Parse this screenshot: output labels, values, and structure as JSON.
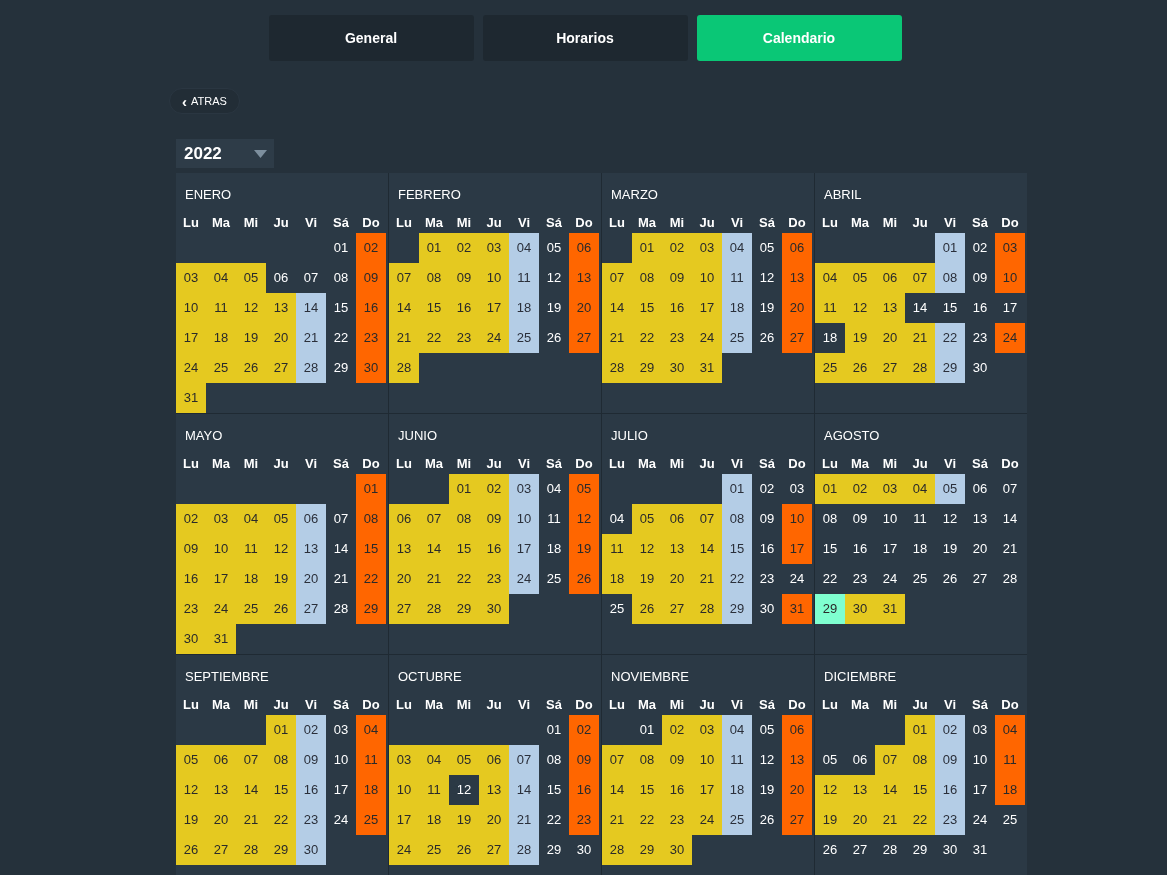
{
  "tabs": [
    {
      "label": "General",
      "selected": false
    },
    {
      "label": "Horarios",
      "selected": false
    },
    {
      "label": "Calendario",
      "selected": true
    }
  ],
  "back_button": {
    "icon": "‹",
    "label": "ATRAS"
  },
  "year_select": {
    "value": "2022"
  },
  "months": [
    {
      "name": "ENERO",
      "weekdays": [
        "Lu",
        "Ma",
        "Mi",
        "Ju",
        "Vi",
        "Sá",
        "Do"
      ],
      "weeks": [
        [
          {
            "kind": "blank"
          },
          {
            "kind": "blank"
          },
          {
            "kind": "blank"
          },
          {
            "kind": "blank"
          },
          {
            "kind": "blank"
          },
          {
            "day": "01",
            "kind": "off"
          },
          {
            "day": "02",
            "kind": "sun"
          }
        ],
        [
          {
            "day": "03",
            "kind": "work"
          },
          {
            "day": "04",
            "kind": "work"
          },
          {
            "day": "05",
            "kind": "work"
          },
          {
            "day": "06",
            "kind": "off"
          },
          {
            "day": "07",
            "kind": "off"
          },
          {
            "day": "08",
            "kind": "off"
          },
          {
            "day": "09",
            "kind": "sun"
          }
        ],
        [
          {
            "day": "10",
            "kind": "work"
          },
          {
            "day": "11",
            "kind": "work"
          },
          {
            "day": "12",
            "kind": "work"
          },
          {
            "day": "13",
            "kind": "work"
          },
          {
            "day": "14",
            "kind": "fri"
          },
          {
            "day": "15",
            "kind": "off"
          },
          {
            "day": "16",
            "kind": "sun"
          }
        ],
        [
          {
            "day": "17",
            "kind": "work"
          },
          {
            "day": "18",
            "kind": "work"
          },
          {
            "day": "19",
            "kind": "work"
          },
          {
            "day": "20",
            "kind": "work"
          },
          {
            "day": "21",
            "kind": "fri"
          },
          {
            "day": "22",
            "kind": "off"
          },
          {
            "day": "23",
            "kind": "sun"
          }
        ],
        [
          {
            "day": "24",
            "kind": "work"
          },
          {
            "day": "25",
            "kind": "work"
          },
          {
            "day": "26",
            "kind": "work"
          },
          {
            "day": "27",
            "kind": "work"
          },
          {
            "day": "28",
            "kind": "fri"
          },
          {
            "day": "29",
            "kind": "off"
          },
          {
            "day": "30",
            "kind": "sun"
          }
        ],
        [
          {
            "day": "31",
            "kind": "work"
          }
        ]
      ]
    },
    {
      "name": "FEBRERO",
      "weekdays": [
        "Lu",
        "Ma",
        "Mi",
        "Ju",
        "Vi",
        "Sá",
        "Do"
      ],
      "weeks": [
        [
          {
            "kind": "blank"
          },
          {
            "day": "01",
            "kind": "work"
          },
          {
            "day": "02",
            "kind": "work"
          },
          {
            "day": "03",
            "kind": "work"
          },
          {
            "day": "04",
            "kind": "fri"
          },
          {
            "day": "05",
            "kind": "off"
          },
          {
            "day": "06",
            "kind": "sun"
          }
        ],
        [
          {
            "day": "07",
            "kind": "work"
          },
          {
            "day": "08",
            "kind": "work"
          },
          {
            "day": "09",
            "kind": "work"
          },
          {
            "day": "10",
            "kind": "work"
          },
          {
            "day": "11",
            "kind": "fri"
          },
          {
            "day": "12",
            "kind": "off"
          },
          {
            "day": "13",
            "kind": "sun"
          }
        ],
        [
          {
            "day": "14",
            "kind": "work"
          },
          {
            "day": "15",
            "kind": "work"
          },
          {
            "day": "16",
            "kind": "work"
          },
          {
            "day": "17",
            "kind": "work"
          },
          {
            "day": "18",
            "kind": "fri"
          },
          {
            "day": "19",
            "kind": "off"
          },
          {
            "day": "20",
            "kind": "sun"
          }
        ],
        [
          {
            "day": "21",
            "kind": "work"
          },
          {
            "day": "22",
            "kind": "work"
          },
          {
            "day": "23",
            "kind": "work"
          },
          {
            "day": "24",
            "kind": "work"
          },
          {
            "day": "25",
            "kind": "fri"
          },
          {
            "day": "26",
            "kind": "off"
          },
          {
            "day": "27",
            "kind": "sun"
          }
        ],
        [
          {
            "day": "28",
            "kind": "work"
          }
        ]
      ]
    },
    {
      "name": "MARZO",
      "weekdays": [
        "Lu",
        "Ma",
        "Mi",
        "Ju",
        "Vi",
        "Sá",
        "Do"
      ],
      "weeks": [
        [
          {
            "kind": "blank"
          },
          {
            "day": "01",
            "kind": "work"
          },
          {
            "day": "02",
            "kind": "work"
          },
          {
            "day": "03",
            "kind": "work"
          },
          {
            "day": "04",
            "kind": "fri"
          },
          {
            "day": "05",
            "kind": "off"
          },
          {
            "day": "06",
            "kind": "sun"
          }
        ],
        [
          {
            "day": "07",
            "kind": "work"
          },
          {
            "day": "08",
            "kind": "work"
          },
          {
            "day": "09",
            "kind": "work"
          },
          {
            "day": "10",
            "kind": "work"
          },
          {
            "day": "11",
            "kind": "fri"
          },
          {
            "day": "12",
            "kind": "off"
          },
          {
            "day": "13",
            "kind": "sun"
          }
        ],
        [
          {
            "day": "14",
            "kind": "work"
          },
          {
            "day": "15",
            "kind": "work"
          },
          {
            "day": "16",
            "kind": "work"
          },
          {
            "day": "17",
            "kind": "work"
          },
          {
            "day": "18",
            "kind": "fri"
          },
          {
            "day": "19",
            "kind": "off"
          },
          {
            "day": "20",
            "kind": "sun"
          }
        ],
        [
          {
            "day": "21",
            "kind": "work"
          },
          {
            "day": "22",
            "kind": "work"
          },
          {
            "day": "23",
            "kind": "work"
          },
          {
            "day": "24",
            "kind": "work"
          },
          {
            "day": "25",
            "kind": "fri"
          },
          {
            "day": "26",
            "kind": "off"
          },
          {
            "day": "27",
            "kind": "sun"
          }
        ],
        [
          {
            "day": "28",
            "kind": "work"
          },
          {
            "day": "29",
            "kind": "work"
          },
          {
            "day": "30",
            "kind": "work"
          },
          {
            "day": "31",
            "kind": "work"
          }
        ]
      ]
    },
    {
      "name": "ABRIL",
      "weekdays": [
        "Lu",
        "Ma",
        "Mi",
        "Ju",
        "Vi",
        "Sá",
        "Do"
      ],
      "weeks": [
        [
          {
            "kind": "blank"
          },
          {
            "kind": "blank"
          },
          {
            "kind": "blank"
          },
          {
            "kind": "blank"
          },
          {
            "day": "01",
            "kind": "fri"
          },
          {
            "day": "02",
            "kind": "off"
          },
          {
            "day": "03",
            "kind": "sun"
          }
        ],
        [
          {
            "day": "04",
            "kind": "work"
          },
          {
            "day": "05",
            "kind": "work"
          },
          {
            "day": "06",
            "kind": "work"
          },
          {
            "day": "07",
            "kind": "work"
          },
          {
            "day": "08",
            "kind": "fri"
          },
          {
            "day": "09",
            "kind": "off"
          },
          {
            "day": "10",
            "kind": "sun"
          }
        ],
        [
          {
            "day": "11",
            "kind": "work"
          },
          {
            "day": "12",
            "kind": "work"
          },
          {
            "day": "13",
            "kind": "work"
          },
          {
            "day": "14",
            "kind": "off"
          },
          {
            "day": "15",
            "kind": "off"
          },
          {
            "day": "16",
            "kind": "off"
          },
          {
            "day": "17",
            "kind": "off"
          }
        ],
        [
          {
            "day": "18",
            "kind": "off"
          },
          {
            "day": "19",
            "kind": "work"
          },
          {
            "day": "20",
            "kind": "work"
          },
          {
            "day": "21",
            "kind": "work"
          },
          {
            "day": "22",
            "kind": "fri"
          },
          {
            "day": "23",
            "kind": "off"
          },
          {
            "day": "24",
            "kind": "sun"
          }
        ],
        [
          {
            "day": "25",
            "kind": "work"
          },
          {
            "day": "26",
            "kind": "work"
          },
          {
            "day": "27",
            "kind": "work"
          },
          {
            "day": "28",
            "kind": "work"
          },
          {
            "day": "29",
            "kind": "fri"
          },
          {
            "day": "30",
            "kind": "off"
          }
        ]
      ]
    },
    {
      "name": "MAYO",
      "weekdays": [
        "Lu",
        "Ma",
        "Mi",
        "Ju",
        "Vi",
        "Sá",
        "Do"
      ],
      "weeks": [
        [
          {
            "kind": "blank"
          },
          {
            "kind": "blank"
          },
          {
            "kind": "blank"
          },
          {
            "kind": "blank"
          },
          {
            "kind": "blank"
          },
          {
            "kind": "blank"
          },
          {
            "day": "01",
            "kind": "sun"
          }
        ],
        [
          {
            "day": "02",
            "kind": "work"
          },
          {
            "day": "03",
            "kind": "work"
          },
          {
            "day": "04",
            "kind": "work"
          },
          {
            "day": "05",
            "kind": "work"
          },
          {
            "day": "06",
            "kind": "fri"
          },
          {
            "day": "07",
            "kind": "off"
          },
          {
            "day": "08",
            "kind": "sun"
          }
        ],
        [
          {
            "day": "09",
            "kind": "work"
          },
          {
            "day": "10",
            "kind": "work"
          },
          {
            "day": "11",
            "kind": "work"
          },
          {
            "day": "12",
            "kind": "work"
          },
          {
            "day": "13",
            "kind": "fri"
          },
          {
            "day": "14",
            "kind": "off"
          },
          {
            "day": "15",
            "kind": "sun"
          }
        ],
        [
          {
            "day": "16",
            "kind": "work"
          },
          {
            "day": "17",
            "kind": "work"
          },
          {
            "day": "18",
            "kind": "work"
          },
          {
            "day": "19",
            "kind": "work"
          },
          {
            "day": "20",
            "kind": "fri"
          },
          {
            "day": "21",
            "kind": "off"
          },
          {
            "day": "22",
            "kind": "sun"
          }
        ],
        [
          {
            "day": "23",
            "kind": "work"
          },
          {
            "day": "24",
            "kind": "work"
          },
          {
            "day": "25",
            "kind": "work"
          },
          {
            "day": "26",
            "kind": "work"
          },
          {
            "day": "27",
            "kind": "fri"
          },
          {
            "day": "28",
            "kind": "off"
          },
          {
            "day": "29",
            "kind": "sun"
          }
        ],
        [
          {
            "day": "30",
            "kind": "work"
          },
          {
            "day": "31",
            "kind": "work"
          }
        ]
      ]
    },
    {
      "name": "JUNIO",
      "weekdays": [
        "Lu",
        "Ma",
        "Mi",
        "Ju",
        "Vi",
        "Sá",
        "Do"
      ],
      "weeks": [
        [
          {
            "kind": "blank"
          },
          {
            "kind": "blank"
          },
          {
            "day": "01",
            "kind": "work"
          },
          {
            "day": "02",
            "kind": "work"
          },
          {
            "day": "03",
            "kind": "fri"
          },
          {
            "day": "04",
            "kind": "off"
          },
          {
            "day": "05",
            "kind": "sun"
          }
        ],
        [
          {
            "day": "06",
            "kind": "work"
          },
          {
            "day": "07",
            "kind": "work"
          },
          {
            "day": "08",
            "kind": "work"
          },
          {
            "day": "09",
            "kind": "work"
          },
          {
            "day": "10",
            "kind": "fri"
          },
          {
            "day": "11",
            "kind": "off"
          },
          {
            "day": "12",
            "kind": "sun"
          }
        ],
        [
          {
            "day": "13",
            "kind": "work"
          },
          {
            "day": "14",
            "kind": "work"
          },
          {
            "day": "15",
            "kind": "work"
          },
          {
            "day": "16",
            "kind": "work"
          },
          {
            "day": "17",
            "kind": "fri"
          },
          {
            "day": "18",
            "kind": "off"
          },
          {
            "day": "19",
            "kind": "sun"
          }
        ],
        [
          {
            "day": "20",
            "kind": "work"
          },
          {
            "day": "21",
            "kind": "work"
          },
          {
            "day": "22",
            "kind": "work"
          },
          {
            "day": "23",
            "kind": "work"
          },
          {
            "day": "24",
            "kind": "fri"
          },
          {
            "day": "25",
            "kind": "off"
          },
          {
            "day": "26",
            "kind": "sun"
          }
        ],
        [
          {
            "day": "27",
            "kind": "work"
          },
          {
            "day": "28",
            "kind": "work"
          },
          {
            "day": "29",
            "kind": "work"
          },
          {
            "day": "30",
            "kind": "work"
          }
        ]
      ]
    },
    {
      "name": "JULIO",
      "weekdays": [
        "Lu",
        "Ma",
        "Mi",
        "Ju",
        "Vi",
        "Sá",
        "Do"
      ],
      "weeks": [
        [
          {
            "kind": "blank"
          },
          {
            "kind": "blank"
          },
          {
            "kind": "blank"
          },
          {
            "kind": "blank"
          },
          {
            "day": "01",
            "kind": "fri"
          },
          {
            "day": "02",
            "kind": "off"
          },
          {
            "day": "03",
            "kind": "off"
          }
        ],
        [
          {
            "day": "04",
            "kind": "off"
          },
          {
            "day": "05",
            "kind": "work"
          },
          {
            "day": "06",
            "kind": "work"
          },
          {
            "day": "07",
            "kind": "work"
          },
          {
            "day": "08",
            "kind": "fri"
          },
          {
            "day": "09",
            "kind": "off"
          },
          {
            "day": "10",
            "kind": "sun"
          }
        ],
        [
          {
            "day": "11",
            "kind": "work"
          },
          {
            "day": "12",
            "kind": "work"
          },
          {
            "day": "13",
            "kind": "work"
          },
          {
            "day": "14",
            "kind": "work"
          },
          {
            "day": "15",
            "kind": "fri"
          },
          {
            "day": "16",
            "kind": "off"
          },
          {
            "day": "17",
            "kind": "sun"
          }
        ],
        [
          {
            "day": "18",
            "kind": "work"
          },
          {
            "day": "19",
            "kind": "work"
          },
          {
            "day": "20",
            "kind": "work"
          },
          {
            "day": "21",
            "kind": "work"
          },
          {
            "day": "22",
            "kind": "fri"
          },
          {
            "day": "23",
            "kind": "off"
          },
          {
            "day": "24",
            "kind": "off"
          }
        ],
        [
          {
            "day": "25",
            "kind": "off"
          },
          {
            "day": "26",
            "kind": "work"
          },
          {
            "day": "27",
            "kind": "work"
          },
          {
            "day": "28",
            "kind": "work"
          },
          {
            "day": "29",
            "kind": "fri"
          },
          {
            "day": "30",
            "kind": "off"
          },
          {
            "day": "31",
            "kind": "sun"
          }
        ]
      ]
    },
    {
      "name": "AGOSTO",
      "weekdays": [
        "Lu",
        "Ma",
        "Mi",
        "Ju",
        "Vi",
        "Sá",
        "Do"
      ],
      "weeks": [
        [
          {
            "day": "01",
            "kind": "work"
          },
          {
            "day": "02",
            "kind": "work"
          },
          {
            "day": "03",
            "kind": "work"
          },
          {
            "day": "04",
            "kind": "work"
          },
          {
            "day": "05",
            "kind": "fri"
          },
          {
            "day": "06",
            "kind": "off"
          },
          {
            "day": "07",
            "kind": "off"
          }
        ],
        [
          {
            "day": "08",
            "kind": "off"
          },
          {
            "day": "09",
            "kind": "off"
          },
          {
            "day": "10",
            "kind": "off"
          },
          {
            "day": "11",
            "kind": "off"
          },
          {
            "day": "12",
            "kind": "off"
          },
          {
            "day": "13",
            "kind": "off"
          },
          {
            "day": "14",
            "kind": "off"
          }
        ],
        [
          {
            "day": "15",
            "kind": "off"
          },
          {
            "day": "16",
            "kind": "off"
          },
          {
            "day": "17",
            "kind": "off"
          },
          {
            "day": "18",
            "kind": "off"
          },
          {
            "day": "19",
            "kind": "off"
          },
          {
            "day": "20",
            "kind": "off"
          },
          {
            "day": "21",
            "kind": "off"
          }
        ],
        [
          {
            "day": "22",
            "kind": "off"
          },
          {
            "day": "23",
            "kind": "off"
          },
          {
            "day": "24",
            "kind": "off"
          },
          {
            "day": "25",
            "kind": "off"
          },
          {
            "day": "26",
            "kind": "off"
          },
          {
            "day": "27",
            "kind": "off"
          },
          {
            "day": "28",
            "kind": "off"
          }
        ],
        [
          {
            "day": "29",
            "kind": "today"
          },
          {
            "day": "30",
            "kind": "work"
          },
          {
            "day": "31",
            "kind": "work"
          }
        ]
      ]
    },
    {
      "name": "SEPTIEMBRE",
      "weekdays": [
        "Lu",
        "Ma",
        "Mi",
        "Ju",
        "Vi",
        "Sá",
        "Do"
      ],
      "weeks": [
        [
          {
            "kind": "blank"
          },
          {
            "kind": "blank"
          },
          {
            "kind": "blank"
          },
          {
            "day": "01",
            "kind": "work"
          },
          {
            "day": "02",
            "kind": "fri"
          },
          {
            "day": "03",
            "kind": "off"
          },
          {
            "day": "04",
            "kind": "sun"
          }
        ],
        [
          {
            "day": "05",
            "kind": "work"
          },
          {
            "day": "06",
            "kind": "work"
          },
          {
            "day": "07",
            "kind": "work"
          },
          {
            "day": "08",
            "kind": "work"
          },
          {
            "day": "09",
            "kind": "fri"
          },
          {
            "day": "10",
            "kind": "off"
          },
          {
            "day": "11",
            "kind": "sun"
          }
        ],
        [
          {
            "day": "12",
            "kind": "work"
          },
          {
            "day": "13",
            "kind": "work"
          },
          {
            "day": "14",
            "kind": "work"
          },
          {
            "day": "15",
            "kind": "work"
          },
          {
            "day": "16",
            "kind": "fri"
          },
          {
            "day": "17",
            "kind": "off"
          },
          {
            "day": "18",
            "kind": "sun"
          }
        ],
        [
          {
            "day": "19",
            "kind": "work"
          },
          {
            "day": "20",
            "kind": "work"
          },
          {
            "day": "21",
            "kind": "work"
          },
          {
            "day": "22",
            "kind": "work"
          },
          {
            "day": "23",
            "kind": "fri"
          },
          {
            "day": "24",
            "kind": "off"
          },
          {
            "day": "25",
            "kind": "sun"
          }
        ],
        [
          {
            "day": "26",
            "kind": "work"
          },
          {
            "day": "27",
            "kind": "work"
          },
          {
            "day": "28",
            "kind": "work"
          },
          {
            "day": "29",
            "kind": "work"
          },
          {
            "day": "30",
            "kind": "fri"
          }
        ]
      ]
    },
    {
      "name": "OCTUBRE",
      "weekdays": [
        "Lu",
        "Ma",
        "Mi",
        "Ju",
        "Vi",
        "Sá",
        "Do"
      ],
      "weeks": [
        [
          {
            "kind": "blank"
          },
          {
            "kind": "blank"
          },
          {
            "kind": "blank"
          },
          {
            "kind": "blank"
          },
          {
            "kind": "blank"
          },
          {
            "day": "01",
            "kind": "off"
          },
          {
            "day": "02",
            "kind": "sun"
          }
        ],
        [
          {
            "day": "03",
            "kind": "work"
          },
          {
            "day": "04",
            "kind": "work"
          },
          {
            "day": "05",
            "kind": "work"
          },
          {
            "day": "06",
            "kind": "work"
          },
          {
            "day": "07",
            "kind": "fri"
          },
          {
            "day": "08",
            "kind": "off"
          },
          {
            "day": "09",
            "kind": "sun"
          }
        ],
        [
          {
            "day": "10",
            "kind": "work"
          },
          {
            "day": "11",
            "kind": "work"
          },
          {
            "day": "12",
            "kind": "off"
          },
          {
            "day": "13",
            "kind": "work"
          },
          {
            "day": "14",
            "kind": "fri"
          },
          {
            "day": "15",
            "kind": "off"
          },
          {
            "day": "16",
            "kind": "sun"
          }
        ],
        [
          {
            "day": "17",
            "kind": "work"
          },
          {
            "day": "18",
            "kind": "work"
          },
          {
            "day": "19",
            "kind": "work"
          },
          {
            "day": "20",
            "kind": "work"
          },
          {
            "day": "21",
            "kind": "fri"
          },
          {
            "day": "22",
            "kind": "off"
          },
          {
            "day": "23",
            "kind": "sun"
          }
        ],
        [
          {
            "day": "24",
            "kind": "work"
          },
          {
            "day": "25",
            "kind": "work"
          },
          {
            "day": "26",
            "kind": "work"
          },
          {
            "day": "27",
            "kind": "work"
          },
          {
            "day": "28",
            "kind": "fri"
          },
          {
            "day": "29",
            "kind": "off"
          },
          {
            "day": "30",
            "kind": "off"
          }
        ]
      ]
    },
    {
      "name": "NOVIEMBRE",
      "weekdays": [
        "Lu",
        "Ma",
        "Mi",
        "Ju",
        "Vi",
        "Sá",
        "Do"
      ],
      "weeks": [
        [
          {
            "kind": "blank"
          },
          {
            "day": "01",
            "kind": "off"
          },
          {
            "day": "02",
            "kind": "work"
          },
          {
            "day": "03",
            "kind": "work"
          },
          {
            "day": "04",
            "kind": "fri"
          },
          {
            "day": "05",
            "kind": "off"
          },
          {
            "day": "06",
            "kind": "sun"
          }
        ],
        [
          {
            "day": "07",
            "kind": "work"
          },
          {
            "day": "08",
            "kind": "work"
          },
          {
            "day": "09",
            "kind": "work"
          },
          {
            "day": "10",
            "kind": "work"
          },
          {
            "day": "11",
            "kind": "fri"
          },
          {
            "day": "12",
            "kind": "off"
          },
          {
            "day": "13",
            "kind": "sun"
          }
        ],
        [
          {
            "day": "14",
            "kind": "work"
          },
          {
            "day": "15",
            "kind": "work"
          },
          {
            "day": "16",
            "kind": "work"
          },
          {
            "day": "17",
            "kind": "work"
          },
          {
            "day": "18",
            "kind": "fri"
          },
          {
            "day": "19",
            "kind": "off"
          },
          {
            "day": "20",
            "kind": "sun"
          }
        ],
        [
          {
            "day": "21",
            "kind": "work"
          },
          {
            "day": "22",
            "kind": "work"
          },
          {
            "day": "23",
            "kind": "work"
          },
          {
            "day": "24",
            "kind": "work"
          },
          {
            "day": "25",
            "kind": "fri"
          },
          {
            "day": "26",
            "kind": "off"
          },
          {
            "day": "27",
            "kind": "sun"
          }
        ],
        [
          {
            "day": "28",
            "kind": "work"
          },
          {
            "day": "29",
            "kind": "work"
          },
          {
            "day": "30",
            "kind": "work"
          }
        ]
      ]
    },
    {
      "name": "DICIEMBRE",
      "weekdays": [
        "Lu",
        "Ma",
        "Mi",
        "Ju",
        "Vi",
        "Sá",
        "Do"
      ],
      "weeks": [
        [
          {
            "kind": "blank"
          },
          {
            "kind": "blank"
          },
          {
            "kind": "blank"
          },
          {
            "day": "01",
            "kind": "work"
          },
          {
            "day": "02",
            "kind": "fri"
          },
          {
            "day": "03",
            "kind": "off"
          },
          {
            "day": "04",
            "kind": "sun"
          }
        ],
        [
          {
            "day": "05",
            "kind": "off"
          },
          {
            "day": "06",
            "kind": "off"
          },
          {
            "day": "07",
            "kind": "work"
          },
          {
            "day": "08",
            "kind": "work"
          },
          {
            "day": "09",
            "kind": "fri"
          },
          {
            "day": "10",
            "kind": "off"
          },
          {
            "day": "11",
            "kind": "sun"
          }
        ],
        [
          {
            "day": "12",
            "kind": "work"
          },
          {
            "day": "13",
            "kind": "work"
          },
          {
            "day": "14",
            "kind": "work"
          },
          {
            "day": "15",
            "kind": "work"
          },
          {
            "day": "16",
            "kind": "fri"
          },
          {
            "day": "17",
            "kind": "off"
          },
          {
            "day": "18",
            "kind": "sun"
          }
        ],
        [
          {
            "day": "19",
            "kind": "work"
          },
          {
            "day": "20",
            "kind": "work"
          },
          {
            "day": "21",
            "kind": "work"
          },
          {
            "day": "22",
            "kind": "work"
          },
          {
            "day": "23",
            "kind": "fri"
          },
          {
            "day": "24",
            "kind": "off"
          },
          {
            "day": "25",
            "kind": "off"
          }
        ],
        [
          {
            "day": "26",
            "kind": "off"
          },
          {
            "day": "27",
            "kind": "off"
          },
          {
            "day": "28",
            "kind": "off"
          },
          {
            "day": "29",
            "kind": "off"
          },
          {
            "day": "30",
            "kind": "off"
          },
          {
            "day": "31",
            "kind": "off"
          }
        ]
      ]
    }
  ]
}
